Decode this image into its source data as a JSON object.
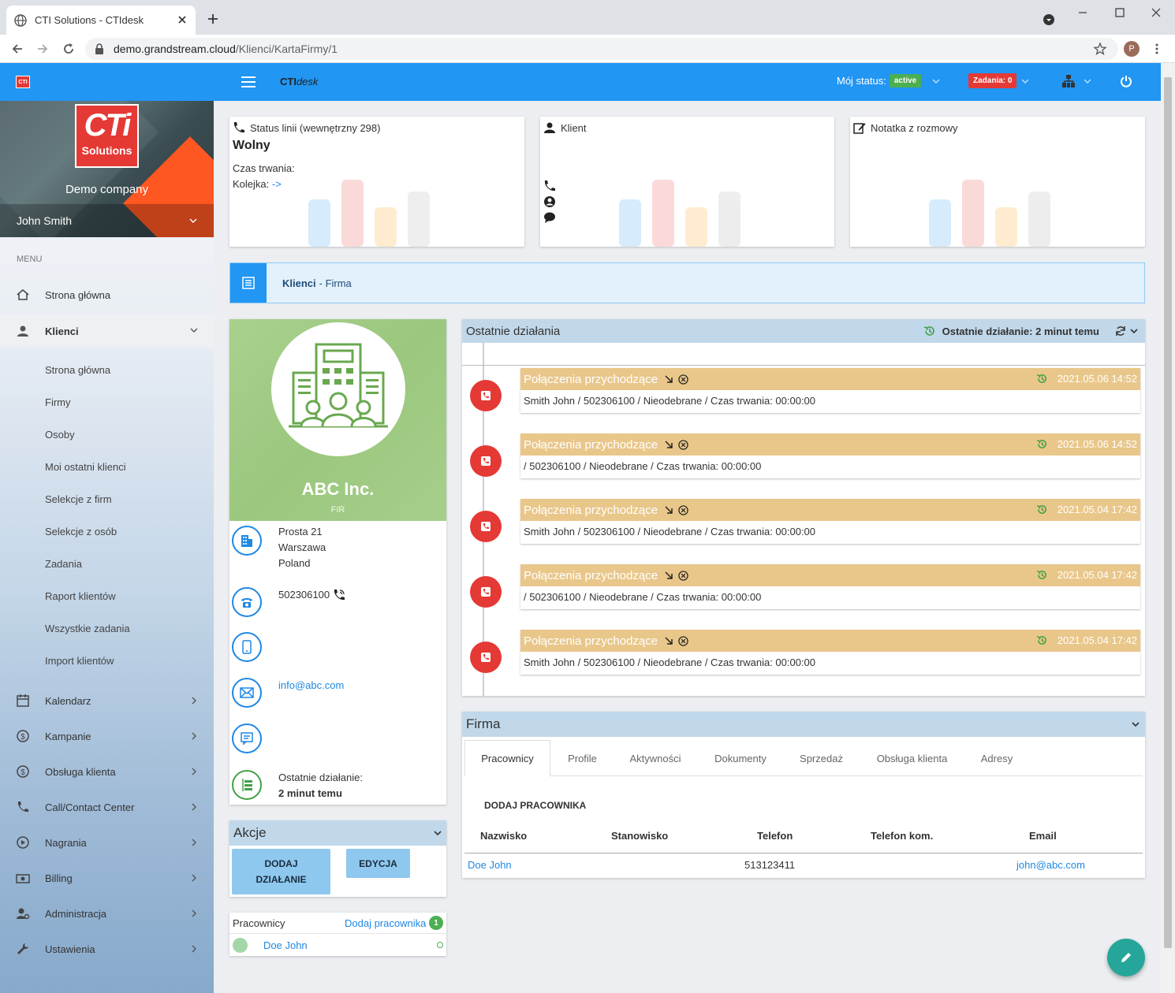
{
  "browser": {
    "tab_title": "CTI Solutions - CTIdesk",
    "url_host": "demo.grandstream.cloud",
    "url_path": "/Klienci/KartaFirmy/1",
    "profile_initial": "P"
  },
  "header": {
    "logo": "CTI",
    "brand_bold": "CTI",
    "brand_italic": "desk",
    "status_label": "Mój status:",
    "status_value": "active",
    "tasks_label": "Zadania: 0"
  },
  "sidebar": {
    "logo_big": "CTi",
    "logo_small": "Solutions",
    "company": "Demo company",
    "user": "John Smith",
    "menu_label": "MENU",
    "items": [
      {
        "label": "Strona główna"
      },
      {
        "label": "Klienci"
      },
      {
        "label": "Kalendarz"
      },
      {
        "label": "Kampanie"
      },
      {
        "label": "Obsługa klienta"
      },
      {
        "label": "Call/Contact Center"
      },
      {
        "label": "Nagrania"
      },
      {
        "label": "Billing"
      },
      {
        "label": "Administracja"
      },
      {
        "label": "Ustawienia"
      }
    ],
    "sub_items": [
      "Strona główna",
      "Firmy",
      "Osoby",
      "Moi ostatni klienci",
      "Selekcje z firm",
      "Selekcje z osób",
      "Zadania",
      "Raport klientów",
      "Wszystkie zadania",
      "Import klientów"
    ]
  },
  "line_status": {
    "title": "Status linii (wewnętrzny 298)",
    "state": "Wolny",
    "duration_label": "Czas trwania:",
    "queue_label": "Kolejka:",
    "queue_value": "->"
  },
  "client_card": {
    "title": "Klient"
  },
  "note_card": {
    "title": "Notatka z rozmowy"
  },
  "breadcrumb": {
    "section": "Klienci",
    "sep": "- Firma"
  },
  "company": {
    "name": "ABC Inc.",
    "sub": "FIR",
    "address": [
      "Prosta 21",
      "Warszawa",
      "Poland"
    ],
    "phone": "502306100",
    "email": "info@abc.com",
    "last_action_label": "Ostatnie działanie:",
    "last_action_value": "2 minut temu"
  },
  "actions": {
    "title": "Akcje",
    "add_line1": "DODAJ",
    "add_line2": "DZIAŁANIE",
    "edit": "EDYCJA"
  },
  "employees_box": {
    "title": "Pracownicy",
    "add_link": "Dodaj pracownika",
    "count": "1",
    "employee": "Doe John"
  },
  "timeline": {
    "title": "Ostatnie działania",
    "last_action": "Ostatnie działanie: 2 minut temu",
    "events": [
      {
        "title": "Połączenia przychodzące",
        "date": "2021.05.06 14:52",
        "body": "Smith John / 502306100 / Nieodebrane / Czas trwania: 00:00:00"
      },
      {
        "title": "Połączenia przychodzące",
        "date": "2021.05.06 14:52",
        "body": "/ 502306100 / Nieodebrane / Czas trwania: 00:00:00"
      },
      {
        "title": "Połączenia przychodzące",
        "date": "2021.05.04 17:42",
        "body": "Smith John / 502306100 / Nieodebrane / Czas trwania: 00:00:00"
      },
      {
        "title": "Połączenia przychodzące",
        "date": "2021.05.04 17:42",
        "body": "/ 502306100 / Nieodebrane / Czas trwania: 00:00:00"
      },
      {
        "title": "Połączenia przychodzące",
        "date": "2021.05.04 17:42",
        "body": "Smith John / 502306100 / Nieodebrane / Czas trwania: 00:00:00"
      }
    ]
  },
  "firma": {
    "title": "Firma",
    "tabs": [
      "Pracownicy",
      "Profile",
      "Aktywności",
      "Dokumenty",
      "Sprzedaż",
      "Obsługa klienta",
      "Adresy"
    ],
    "add_button": "DODAJ PRACOWNIKA",
    "columns": [
      "Nazwisko",
      "Stanowisko",
      "Telefon",
      "Telefon kom.",
      "Email"
    ],
    "rows": [
      {
        "name": "Doe John",
        "position": "",
        "phone": "513123411",
        "mobile": "",
        "email": "john@abc.com"
      }
    ]
  },
  "colors": {
    "primary": "#2196f3",
    "danger": "#e53935",
    "event": "#e9c78a",
    "success": "#4caf50",
    "fab": "#26a69a"
  }
}
